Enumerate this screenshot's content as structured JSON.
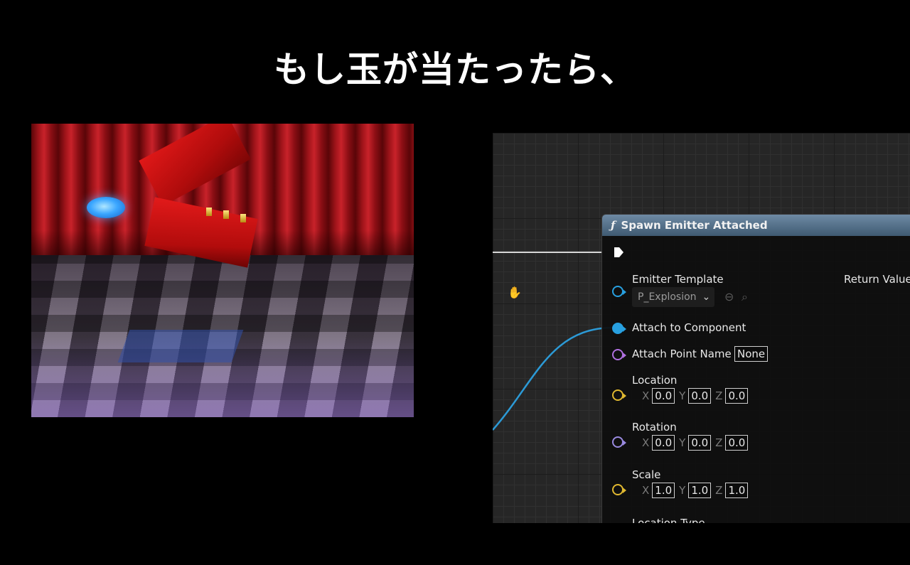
{
  "caption": "もし玉が当たったら、",
  "node": {
    "title": "Spawn Emitter Attached",
    "return_label": "Return Value",
    "emitter_template": {
      "label": "Emitter Template",
      "value": "P_Explosion"
    },
    "attach_to_component": {
      "label": "Attach to Component"
    },
    "attach_point_name": {
      "label": "Attach Point Name",
      "value": "None"
    },
    "location": {
      "label": "Location",
      "x": "0.0",
      "y": "0.0",
      "z": "0.0"
    },
    "rotation": {
      "label": "Rotation",
      "x": "0.0",
      "y": "0.0",
      "z": "0.0"
    },
    "scale": {
      "label": "Scale",
      "x": "1.0",
      "y": "1.0",
      "z": "1.0"
    },
    "location_type": {
      "label": "Location Type"
    },
    "axis_labels": {
      "x": "X",
      "y": "Y",
      "z": "Z"
    }
  },
  "colors": {
    "object_pin": "#28a0e0",
    "name_pin": "#b070e0",
    "vector_pin": "#e0b830",
    "rotator_pin": "#9a8ae0",
    "header": "#4f6a84"
  },
  "icons": [
    "fn-icon",
    "exec-pin-icon",
    "chevron-down-icon",
    "browse-arrow-icon",
    "search-icon",
    "hand-cursor-icon"
  ]
}
